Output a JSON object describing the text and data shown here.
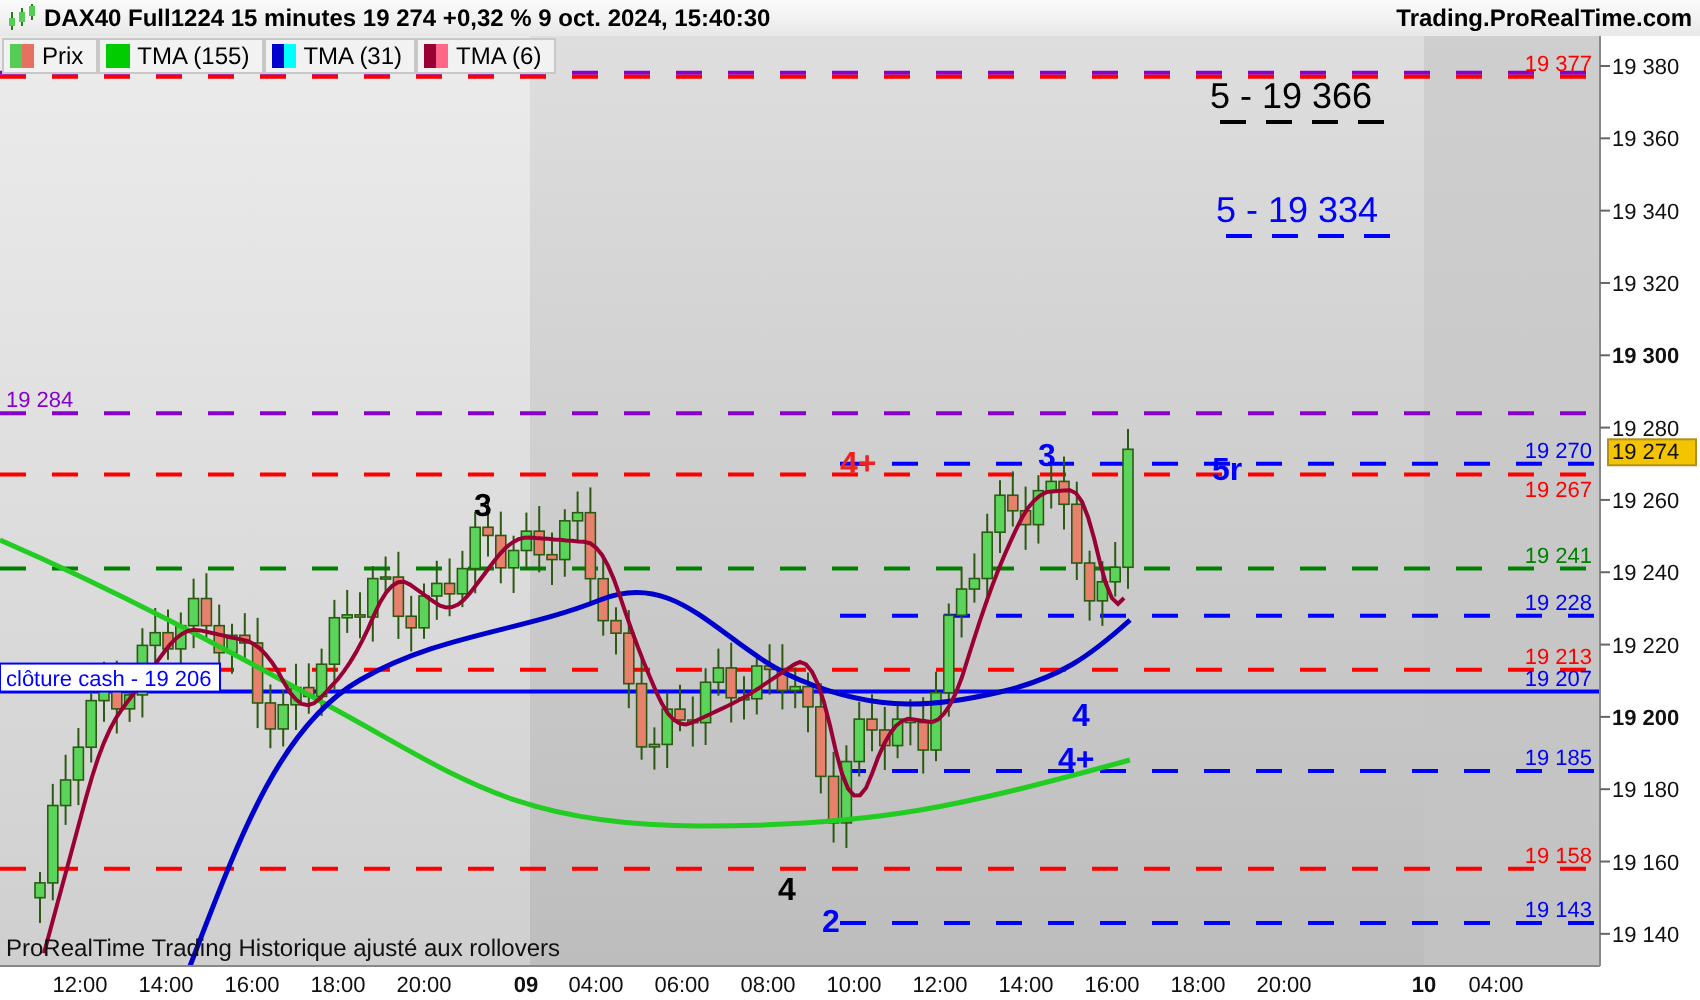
{
  "header": {
    "title": "DAX40 Full1224 15 minutes 19 274 +0,32 % 9 oct. 2024, 15:40:30",
    "site": "Trading.ProRealTime.com"
  },
  "legend": [
    {
      "label": "Prix",
      "kind": "price"
    },
    {
      "label": "TMA (155)",
      "kind": "tma155"
    },
    {
      "label": "TMA (31)",
      "kind": "tma31"
    },
    {
      "label": "TMA (6)",
      "kind": "tma6"
    }
  ],
  "price_axis": {
    "ticks": [
      {
        "label": "19 380",
        "kind": "minor"
      },
      {
        "label": "19 360",
        "kind": "minor"
      },
      {
        "label": "19 340",
        "kind": "minor"
      },
      {
        "label": "19 320",
        "kind": "minor"
      },
      {
        "label": "19 300",
        "kind": "major"
      },
      {
        "label": "19 280",
        "kind": "minor"
      },
      {
        "label": "19 260",
        "kind": "minor"
      },
      {
        "label": "19 240",
        "kind": "minor"
      },
      {
        "label": "19 220",
        "kind": "minor"
      },
      {
        "label": "19 200",
        "kind": "major"
      },
      {
        "label": "19 180",
        "kind": "minor"
      },
      {
        "label": "19 160",
        "kind": "minor"
      },
      {
        "label": "19 140",
        "kind": "minor"
      }
    ],
    "current_price": "19 274"
  },
  "time_axis": [
    {
      "label": "12:00",
      "kind": "hour"
    },
    {
      "label": "14:00",
      "kind": "hour"
    },
    {
      "label": "16:00",
      "kind": "hour"
    },
    {
      "label": "18:00",
      "kind": "hour"
    },
    {
      "label": "20:00",
      "kind": "hour"
    },
    {
      "label": "09",
      "kind": "day"
    },
    {
      "label": "04:00",
      "kind": "hour"
    },
    {
      "label": "06:00",
      "kind": "hour"
    },
    {
      "label": "08:00",
      "kind": "hour"
    },
    {
      "label": "10:00",
      "kind": "hour"
    },
    {
      "label": "12:00",
      "kind": "hour"
    },
    {
      "label": "14:00",
      "kind": "hour"
    },
    {
      "label": "16:00",
      "kind": "hour"
    },
    {
      "label": "18:00",
      "kind": "hour"
    },
    {
      "label": "20:00",
      "kind": "hour"
    },
    {
      "label": "10",
      "kind": "day"
    },
    {
      "label": "04:00",
      "kind": "hour"
    }
  ],
  "levels": [
    {
      "price": "19 377",
      "color": "#ff0000",
      "kind": "double"
    },
    {
      "price": "19 284",
      "color": "#8800cc",
      "kind": "left-label"
    },
    {
      "price": "19 270",
      "color": "#0000ff",
      "kind": "session"
    },
    {
      "price": "19 267",
      "color": "#ff0000",
      "kind": "full"
    },
    {
      "price": "19 241",
      "color": "#008000",
      "kind": "full"
    },
    {
      "price": "19 228",
      "color": "#0000ff",
      "kind": "session"
    },
    {
      "price": "19 213",
      "color": "#ff0000",
      "kind": "full"
    },
    {
      "price": "19 207",
      "color": "#0000ff",
      "kind": "solid"
    },
    {
      "price": "19 185",
      "color": "#0000ff",
      "kind": "session"
    },
    {
      "price": "19 158",
      "color": "#ff0000",
      "kind": "full"
    },
    {
      "price": "19 143",
      "color": "#0000ff",
      "kind": "session"
    }
  ],
  "close_label": "clôture cash -  19 206",
  "annotations": [
    {
      "text": "5 -  19 366",
      "color": "#000000",
      "kind": "target"
    },
    {
      "text": "5 - 19 334",
      "color": "#0000ff",
      "kind": "target"
    },
    {
      "text": "3",
      "color": "#000000",
      "kind": "wave"
    },
    {
      "text": "4",
      "color": "#000000",
      "kind": "wave"
    },
    {
      "text": "2",
      "color": "#0000ff",
      "kind": "wave"
    },
    {
      "text": "4+",
      "color": "#ee2222",
      "kind": "wave"
    },
    {
      "text": "3",
      "color": "#0000ff",
      "kind": "wave"
    },
    {
      "text": "5r",
      "color": "#0000ff",
      "kind": "wave"
    },
    {
      "text": "4",
      "color": "#0000ff",
      "kind": "wave"
    },
    {
      "text": "4+",
      "color": "#0000ff",
      "kind": "wave"
    }
  ],
  "footer": "ProRealTime Trading  Historique ajusté aux rollovers"
}
